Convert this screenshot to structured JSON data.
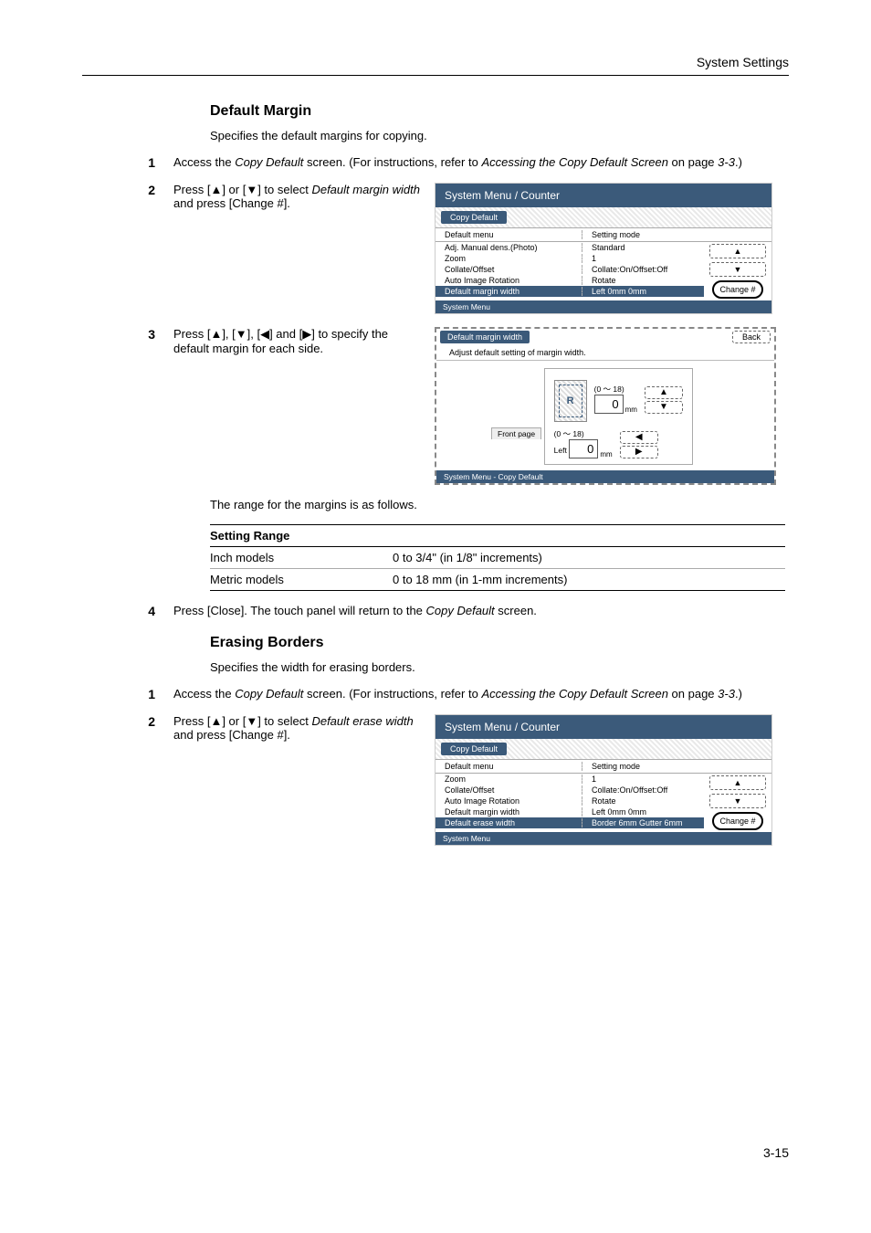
{
  "running_head": "System Settings",
  "page_number": "3-15",
  "section1": {
    "title": "Default Margin",
    "intro": "Specifies the default margins for copying.",
    "step1_num": "1",
    "step1_a": "Access the ",
    "step1_b": "Copy Default",
    "step1_c": " screen. (For instructions, refer to ",
    "step1_d": "Accessing the Copy Default Screen",
    "step1_e": " on page ",
    "step1_f": "3-3",
    "step1_g": ".)",
    "step2_num": "2",
    "step2_a": "Press [▲] or [▼] to select ",
    "step2_b": "Default margin width",
    "step2_c": " and press [Change #].",
    "step3_num": "3",
    "step3_a": "Press [▲], [▼], [◀] and [▶] to specify the default margin for each side.",
    "range_intro": "The range for the margins is as follows.",
    "step4_num": "4",
    "step4_a": "Press [Close]. The touch panel will return to the ",
    "step4_b": "Copy Default",
    "step4_c": " screen."
  },
  "screen1": {
    "title": "System Menu / Counter",
    "tab": "Copy Default",
    "head_left": "Default menu",
    "head_right": "Setting mode",
    "rows": [
      {
        "l": "Adj. Manual dens.(Photo)",
        "r": "Standard"
      },
      {
        "l": "Zoom",
        "r": "1"
      },
      {
        "l": "Collate/Offset",
        "r": "Collate:On/Offset:Off"
      },
      {
        "l": "Auto Image Rotation",
        "r": "Rotate"
      },
      {
        "l": "Default margin width",
        "r": "Left    0mm       0mm",
        "sel": true
      }
    ],
    "btn_up": "▲",
    "btn_down": "▼",
    "btn_change": "Change #",
    "footer": "System Menu"
  },
  "screen2": {
    "title": "Default margin width",
    "back": "Back",
    "subtitle": "Adjust default setting of margin width.",
    "front": "Front page",
    "range": "(0 ～ 18)",
    "val_top": "0",
    "unit": "mm",
    "left_label": "Left",
    "val_left": "0",
    "up": "▲",
    "down": "▼",
    "lft": "◀",
    "rgt": "▶",
    "footer": "System Menu        -   Copy Default"
  },
  "table": {
    "head": "Setting Range",
    "r1a": "Inch models",
    "r1b": "0 to 3/4\" (in 1/8\" increments)",
    "r2a": "Metric models",
    "r2b": "0 to 18 mm (in 1-mm increments)"
  },
  "section2": {
    "title": "Erasing Borders",
    "intro": "Specifies the width for erasing borders.",
    "step1_num": "1",
    "step1_a": "Access the ",
    "step1_b": "Copy Default",
    "step1_c": " screen. (For instructions, refer to ",
    "step1_d": "Accessing the Copy Default Screen",
    "step1_e": " on page ",
    "step1_f": "3-3",
    "step1_g": ".)",
    "step2_num": "2",
    "step2_a": "Press [▲] or [▼] to select ",
    "step2_b": "Default erase width",
    "step2_c": " and press [Change #]."
  },
  "screen3": {
    "title": "System Menu / Counter",
    "tab": "Copy Default",
    "head_left": "Default menu",
    "head_right": "Setting mode",
    "rows": [
      {
        "l": "Zoom",
        "r": "1"
      },
      {
        "l": "Collate/Offset",
        "r": "Collate:On/Offset:Off"
      },
      {
        "l": "Auto Image Rotation",
        "r": "Rotate"
      },
      {
        "l": "Default margin width",
        "r": "Left  0mm       0mm"
      },
      {
        "l": "Default erase width",
        "r": "Border 6mm   Gutter 6mm",
        "sel": true
      }
    ],
    "btn_up": "▲",
    "btn_down": "▼",
    "btn_change": "Change #",
    "footer": "System Menu"
  }
}
